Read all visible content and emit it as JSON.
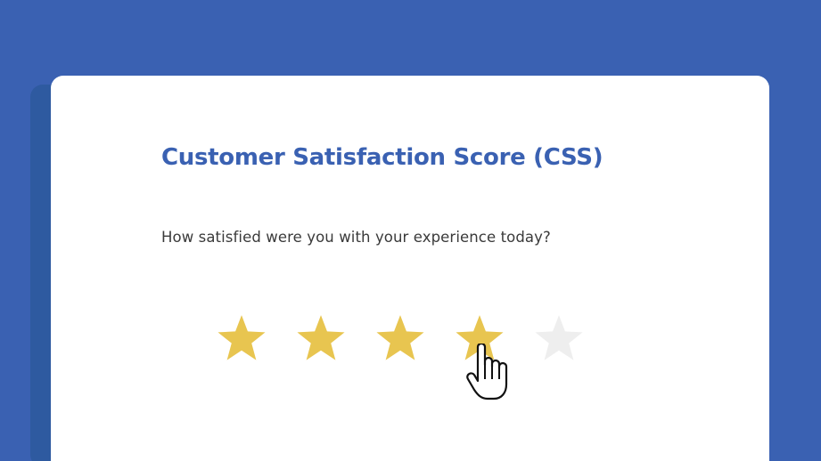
{
  "survey": {
    "title": "Customer Satisfaction Score (CSS)",
    "question": "How satisfied were you with your experience today?"
  },
  "rating": {
    "value": 4,
    "max": 5,
    "filled_color": "#e8c550",
    "empty_color": "#eeeeee",
    "star_icon": "star-icon"
  },
  "cursor": {
    "icon": "hand-pointer-icon",
    "hovering_star": 4
  },
  "colors": {
    "background": "#3a61b2",
    "accent": "#3a61b2",
    "card": "#ffffff"
  }
}
